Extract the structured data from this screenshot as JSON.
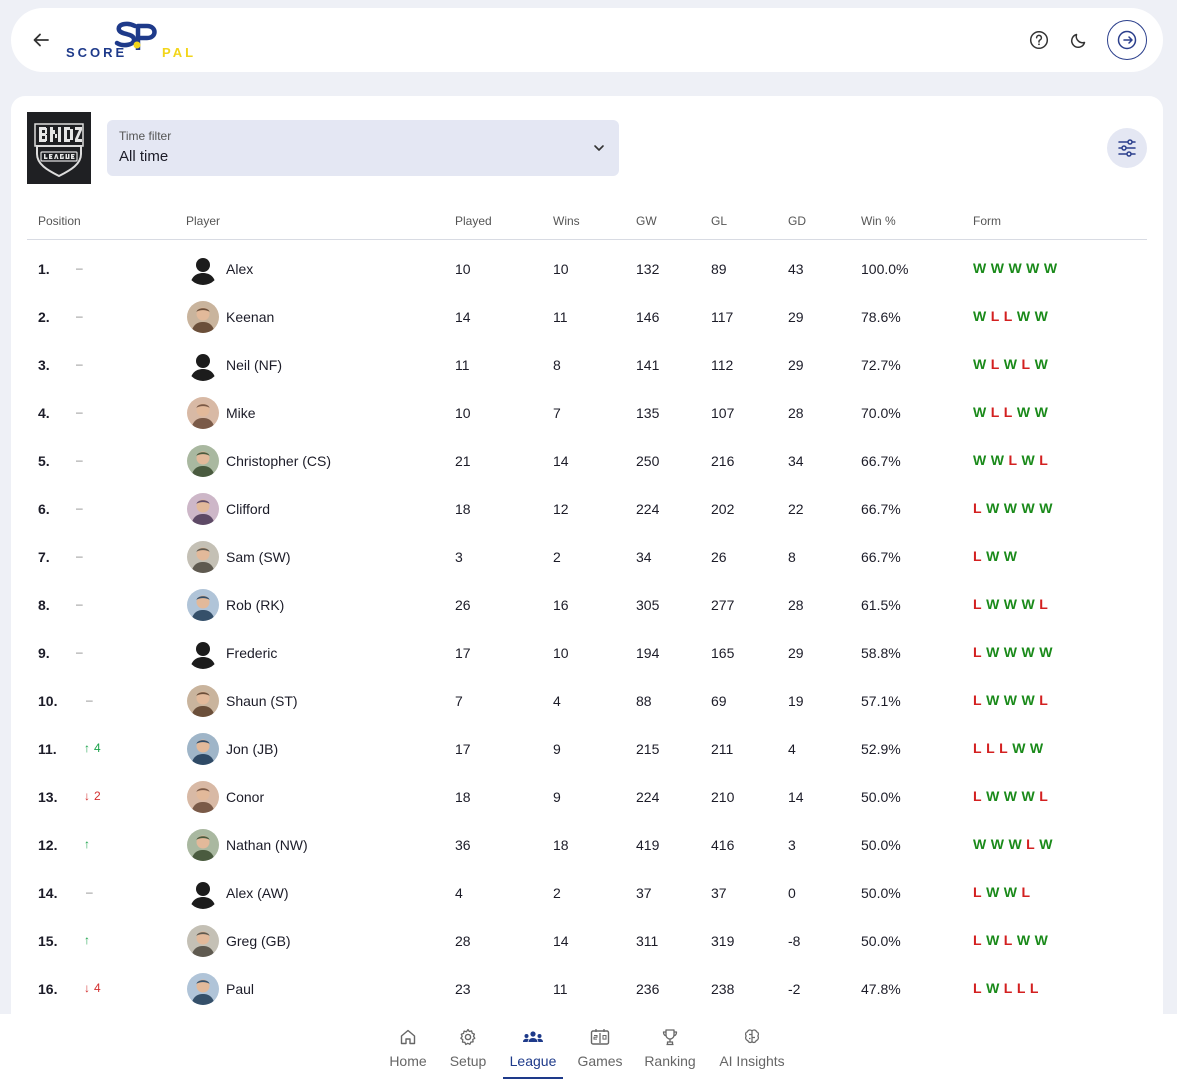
{
  "header": {
    "logo_left": "SCORE",
    "logo_right": "PAL"
  },
  "filter": {
    "label": "Time filter",
    "value": "All time"
  },
  "table": {
    "columns": [
      "Position",
      "Player",
      "Played",
      "Wins",
      "GW",
      "GL",
      "GD",
      "Win %",
      "Form"
    ],
    "rows": [
      {
        "pos": "1.",
        "change": "–",
        "dir": "none",
        "name": "Alex",
        "avatar": "silhouette",
        "played": "10",
        "wins": "10",
        "gw": "132",
        "gl": "89",
        "gd": "43",
        "winpct": "100.0%",
        "form": [
          "W",
          "W",
          "W",
          "W",
          "W"
        ]
      },
      {
        "pos": "2.",
        "change": "–",
        "dir": "none",
        "name": "Keenan",
        "avatar": "photo",
        "played": "14",
        "wins": "11",
        "gw": "146",
        "gl": "117",
        "gd": "29",
        "winpct": "78.6%",
        "form": [
          "W",
          "L",
          "L",
          "W",
          "W"
        ]
      },
      {
        "pos": "3.",
        "change": "–",
        "dir": "none",
        "name": "Neil (NF)",
        "avatar": "silhouette",
        "played": "11",
        "wins": "8",
        "gw": "141",
        "gl": "112",
        "gd": "29",
        "winpct": "72.7%",
        "form": [
          "W",
          "L",
          "W",
          "L",
          "W"
        ]
      },
      {
        "pos": "4.",
        "change": "–",
        "dir": "none",
        "name": "Mike",
        "avatar": "photo",
        "played": "10",
        "wins": "7",
        "gw": "135",
        "gl": "107",
        "gd": "28",
        "winpct": "70.0%",
        "form": [
          "W",
          "L",
          "L",
          "W",
          "W"
        ]
      },
      {
        "pos": "5.",
        "change": "–",
        "dir": "none",
        "name": "Christopher (CS)",
        "avatar": "photo",
        "played": "21",
        "wins": "14",
        "gw": "250",
        "gl": "216",
        "gd": "34",
        "winpct": "66.7%",
        "form": [
          "W",
          "W",
          "L",
          "W",
          "L"
        ]
      },
      {
        "pos": "6.",
        "change": "–",
        "dir": "none",
        "name": "Clifford",
        "avatar": "photo",
        "played": "18",
        "wins": "12",
        "gw": "224",
        "gl": "202",
        "gd": "22",
        "winpct": "66.7%",
        "form": [
          "L",
          "W",
          "W",
          "W",
          "W"
        ]
      },
      {
        "pos": "7.",
        "change": "–",
        "dir": "none",
        "name": "Sam (SW)",
        "avatar": "photo",
        "played": "3",
        "wins": "2",
        "gw": "34",
        "gl": "26",
        "gd": "8",
        "winpct": "66.7%",
        "form": [
          "L",
          "W",
          "W"
        ]
      },
      {
        "pos": "8.",
        "change": "–",
        "dir": "none",
        "name": "Rob (RK)",
        "avatar": "photo",
        "played": "26",
        "wins": "16",
        "gw": "305",
        "gl": "277",
        "gd": "28",
        "winpct": "61.5%",
        "form": [
          "L",
          "W",
          "W",
          "W",
          "L"
        ]
      },
      {
        "pos": "9.",
        "change": "–",
        "dir": "none",
        "name": "Frederic",
        "avatar": "silhouette",
        "played": "17",
        "wins": "10",
        "gw": "194",
        "gl": "165",
        "gd": "29",
        "winpct": "58.8%",
        "form": [
          "L",
          "W",
          "W",
          "W",
          "W"
        ]
      },
      {
        "pos": "10.",
        "change": "–",
        "dir": "none",
        "name": "Shaun (ST)",
        "avatar": "photo",
        "played": "7",
        "wins": "4",
        "gw": "88",
        "gl": "69",
        "gd": "19",
        "winpct": "57.1%",
        "form": [
          "L",
          "W",
          "W",
          "W",
          "L"
        ]
      },
      {
        "pos": "11.",
        "change": "4",
        "dir": "up",
        "name": "Jon (JB)",
        "avatar": "photo",
        "played": "17",
        "wins": "9",
        "gw": "215",
        "gl": "211",
        "gd": "4",
        "winpct": "52.9%",
        "form": [
          "L",
          "L",
          "L",
          "W",
          "W"
        ]
      },
      {
        "pos": "13.",
        "change": "2",
        "dir": "down",
        "name": "Conor",
        "avatar": "photo",
        "played": "18",
        "wins": "9",
        "gw": "224",
        "gl": "210",
        "gd": "14",
        "winpct": "50.0%",
        "form": [
          "L",
          "W",
          "W",
          "W",
          "L"
        ]
      },
      {
        "pos": "12.",
        "change": "",
        "dir": "up",
        "name": "Nathan (NW)",
        "avatar": "photo",
        "played": "36",
        "wins": "18",
        "gw": "419",
        "gl": "416",
        "gd": "3",
        "winpct": "50.0%",
        "form": [
          "W",
          "W",
          "W",
          "L",
          "W"
        ]
      },
      {
        "pos": "14.",
        "change": "–",
        "dir": "none",
        "name": "Alex (AW)",
        "avatar": "silhouette",
        "played": "4",
        "wins": "2",
        "gw": "37",
        "gl": "37",
        "gd": "0",
        "winpct": "50.0%",
        "form": [
          "L",
          "W",
          "W",
          "L"
        ]
      },
      {
        "pos": "15.",
        "change": "",
        "dir": "up",
        "name": "Greg (GB)",
        "avatar": "photo",
        "played": "28",
        "wins": "14",
        "gw": "311",
        "gl": "319",
        "gd": "-8",
        "winpct": "50.0%",
        "form": [
          "L",
          "W",
          "L",
          "W",
          "W"
        ]
      },
      {
        "pos": "16.",
        "change": "4",
        "dir": "down",
        "name": "Paul",
        "avatar": "photo",
        "played": "23",
        "wins": "11",
        "gw": "236",
        "gl": "238",
        "gd": "-2",
        "winpct": "47.8%",
        "form": [
          "L",
          "W",
          "L",
          "L",
          "L"
        ]
      }
    ]
  },
  "nav": {
    "items": [
      {
        "label": "Home",
        "icon": "home-icon"
      },
      {
        "label": "Setup",
        "icon": "gear-icon"
      },
      {
        "label": "League",
        "icon": "group-icon"
      },
      {
        "label": "Games",
        "icon": "scoreboard-icon"
      },
      {
        "label": "Ranking",
        "icon": "trophy-icon"
      },
      {
        "label": "AI Insights",
        "icon": "brain-icon"
      }
    ],
    "active": "League"
  },
  "colors": {
    "brand_blue": "#1e3a8a",
    "brand_yellow": "#f2d51a",
    "win": "#1a8a1a",
    "loss": "#d32020",
    "up": "#1aa34a",
    "down": "#d32f2f"
  }
}
